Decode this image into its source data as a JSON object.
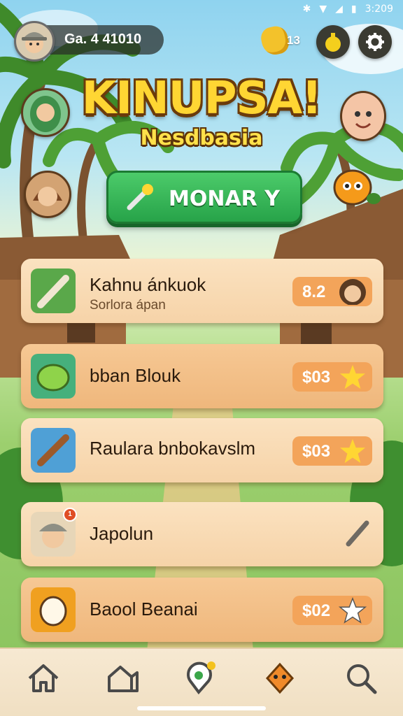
{
  "status": {
    "time": "3:209"
  },
  "profile": {
    "id_text": "Ga. 4 41010"
  },
  "currency": {
    "count": "13",
    "icon": "gold-nugget-icon"
  },
  "header_buttons": {
    "potion_icon": "potion-icon",
    "settings_icon": "gear-icon"
  },
  "game": {
    "title": "KINUPSA!",
    "subtitle": "Nesdbasia"
  },
  "main_button": {
    "label": "MONAR Y"
  },
  "cards": [
    {
      "title": "Kahnu ánkuok",
      "subtitle": "Sorlora ápan",
      "price": "8.2",
      "right_icon": "girl-avatar"
    },
    {
      "title": "bban Blouk",
      "price": "$03",
      "right_icon": "star-icon"
    },
    {
      "title": "Raulara bnbokavslm",
      "price": "$03",
      "right_icon": "star-icon"
    },
    {
      "title": "Japolun",
      "badge": "1",
      "right_icon": "brush-icon"
    },
    {
      "title": "Baool Beanai",
      "price": "$02",
      "right_icon": "star-icon"
    }
  ],
  "nav": [
    {
      "icon": "home-icon"
    },
    {
      "icon": "village-house-icon"
    },
    {
      "icon": "map-pin-icon"
    },
    {
      "icon": "orange-creature-icon"
    },
    {
      "icon": "search-icon"
    }
  ],
  "colors": {
    "accent_green": "#27a349",
    "title_yellow": "#ffd633",
    "card_bg": "#fbe2c0",
    "price_orange": "#f3a45a"
  }
}
